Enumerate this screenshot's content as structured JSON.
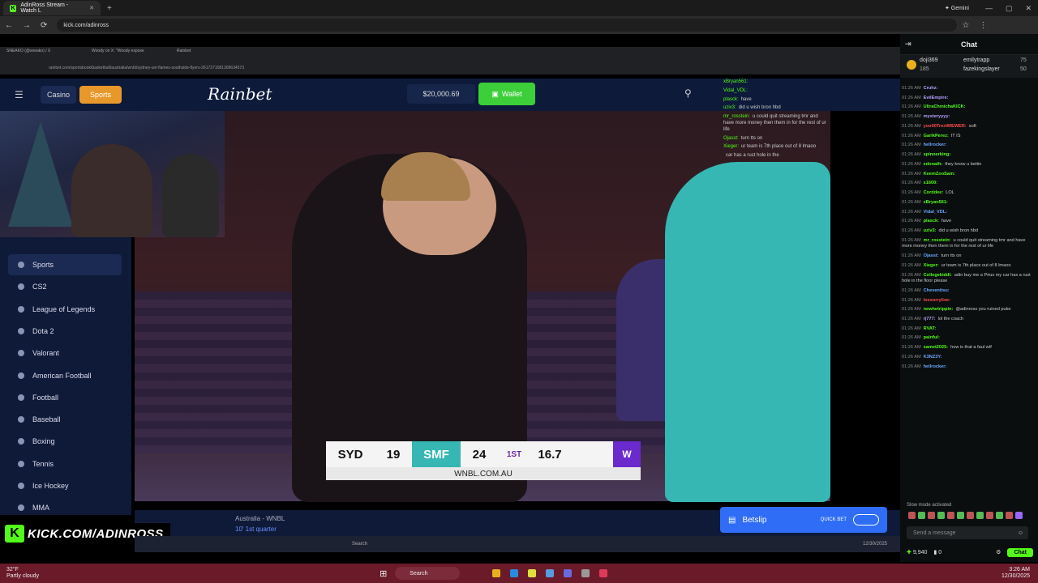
{
  "browser": {
    "tab_title": "AdinRoss Stream - Watch L",
    "gemini": "Gemini",
    "url": "kick.com/adinross"
  },
  "inner_browser": {
    "tabs": [
      "SNEAKO (@sneako) / X",
      "Woody on X: \"Woody expose",
      "Rainbet"
    ],
    "url": "rainbet.com/sportsbook/basketball/australia/wnbl/sydney-uni-flames-southside-flyers-2617271081309634573"
  },
  "rainbet": {
    "casino": "Casino",
    "sports": "Sports",
    "logo": "Rainbet",
    "balance": "$20,000.69",
    "wallet": "Wallet",
    "sidebar": [
      "Sports",
      "CS2",
      "League of Legends",
      "Dota 2",
      "Valorant",
      "American Football",
      "Football",
      "Baseball",
      "Boxing",
      "Tennis",
      "Ice Hockey",
      "MMA"
    ],
    "league": "Australia - WNBL",
    "quarter": "10' 1st quarter",
    "betslip": "Betslip",
    "quickbet": "QUICK BET"
  },
  "scorebug": {
    "team1": "SYD",
    "score1": "19",
    "team2": "SMF",
    "score2": "24",
    "quarter": "1ST",
    "clock": "16.7",
    "site": "WNBL.COM.AU"
  },
  "overlay": {
    "lines": [
      {
        "user": "xBryan561:",
        "text": ""
      },
      {
        "user": "Vidal_VDL:",
        "text": ""
      },
      {
        "user": "plasck:",
        "text": "have"
      },
      {
        "user": "uziv3:",
        "text": "did u wish bron hbd"
      },
      {
        "user": "mr_rosstein:",
        "text": "u could quit streaming tmr and have more money then them in for the rest of ur life"
      },
      {
        "user": "Ojasst:",
        "text": "turn tts on"
      },
      {
        "user": "Xieger:",
        "text": "ur team is 7th place out of 8 lmaoo"
      },
      {
        "user": "",
        "text": "car has a rust hole in the"
      }
    ]
  },
  "kick_tag": "KICK.COM/ADINROSS",
  "chat": {
    "title": "Chat",
    "leaderboard": [
      {
        "name": "doji369",
        "amount": "185"
      },
      {
        "name": "emilytrapp",
        "amount": "75"
      },
      {
        "name": "fazekingslayer",
        "amount": "50"
      }
    ],
    "messages": [
      {
        "time": "01:26 AM",
        "user": "Cruhz:",
        "text": "",
        "color": "#b9a0ff"
      },
      {
        "time": "01:26 AM",
        "user": "EvilEmpire:",
        "text": "",
        "color": "#b9a0ff"
      },
      {
        "time": "01:26 AM",
        "user": "UltraChmichaKICK:",
        "text": "",
        "color": "#53fc18"
      },
      {
        "time": "01:26 AM",
        "user": "mysteryyyy:",
        "text": "",
        "color": "#b9a0ff"
      },
      {
        "time": "01:26 AM",
        "user": "yoo00TrexWIEWER:",
        "text": "soft",
        "color": "#ff4d4d"
      },
      {
        "time": "01:26 AM",
        "user": "GarikPerez:",
        "text": "IT IS",
        "color": "#53fc18"
      },
      {
        "time": "01:26 AM",
        "user": "hellrocker:",
        "text": "",
        "color": "#6aa8ff"
      },
      {
        "time": "01:26 AM",
        "user": "spinnerking:",
        "text": "",
        "color": "#53fc18"
      },
      {
        "time": "01:26 AM",
        "user": "edonath:",
        "text": "they know u bettin",
        "color": "#53fc18"
      },
      {
        "time": "01:26 AM",
        "user": "KeemZooSam:",
        "text": "",
        "color": "#53fc18"
      },
      {
        "time": "01:26 AM",
        "user": "s1600:",
        "text": "",
        "color": "#53fc18"
      },
      {
        "time": "01:26 AM",
        "user": "Corddee:",
        "text": "LOL",
        "color": "#53fc18"
      },
      {
        "time": "01:26 AM",
        "user": "xBryan561:",
        "text": "",
        "color": "#53fc18"
      },
      {
        "time": "01:26 AM",
        "user": "Vidal_VDL:",
        "text": "",
        "color": "#6aa8ff"
      },
      {
        "time": "01:26 AM",
        "user": "plasck:",
        "text": "have",
        "color": "#53fc18"
      },
      {
        "time": "01:26 AM",
        "user": "uziv3:",
        "text": "did u wish bron hbd",
        "color": "#53fc18"
      },
      {
        "time": "01:26 AM",
        "user": "mr_rosstein:",
        "text": "u could quit streaming tmr and have more money then them in for the rest of ur life",
        "color": "#53fc18"
      },
      {
        "time": "01:26 AM",
        "user": "Ojasst:",
        "text": "turn tts on",
        "color": "#6aa8ff"
      },
      {
        "time": "01:26 AM",
        "user": "Xieger:",
        "text": "ur team is 7th place out of 8 lmaoo",
        "color": "#53fc18"
      },
      {
        "time": "01:26 AM",
        "user": "Collegekiddl:",
        "text": "adin buy me a Prius my car has a rust hole in the floor please",
        "color": "#53fc18"
      },
      {
        "time": "01:26 AM",
        "user": "Chevenitsu:",
        "text": "",
        "color": "#6aa8ff"
      },
      {
        "time": "01:26 AM",
        "user": "lossorrylive:",
        "text": "",
        "color": "#ff4d4d"
      },
      {
        "time": "01:26 AM",
        "user": "newhetrippin:",
        "text": "@adinross you ruined puke",
        "color": "#53fc18"
      },
      {
        "time": "01:26 AM",
        "user": "rj777:",
        "text": "lol the coach",
        "color": "#b9a0ff"
      },
      {
        "time": "01:26 AM",
        "user": "RVAT:",
        "text": "",
        "color": "#53fc18"
      },
      {
        "time": "01:26 AM",
        "user": "painful:",
        "text": "",
        "color": "#53fc18"
      },
      {
        "time": "01:26 AM",
        "user": "samet2025:",
        "text": "how is that a faul wtf",
        "color": "#53fc18"
      },
      {
        "time": "01:26 AM",
        "user": "K3NZ3Y:",
        "text": "",
        "color": "#6aa8ff"
      },
      {
        "time": "01:26 AM",
        "user": "hellrocker:",
        "text": "",
        "color": "#6aa8ff"
      }
    ],
    "slow_mode": "Slow mode activated",
    "send_placeholder": "Send a message",
    "points": "9,940",
    "count": "0",
    "chat_button": "Chat"
  },
  "taskbar": {
    "temp": "32°F",
    "weather": "Partly cloudy",
    "search": "Search",
    "time": "3:26 AM",
    "date": "12/30/2025"
  },
  "inner_taskbar": {
    "search": "Search",
    "date": "12/30/2025"
  }
}
